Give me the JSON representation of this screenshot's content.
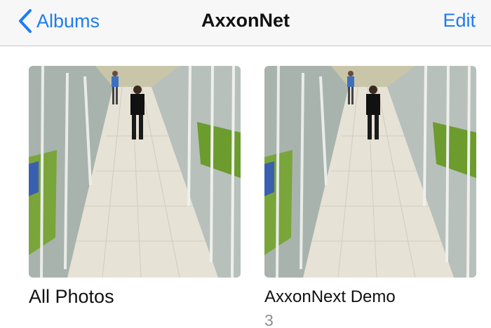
{
  "navbar": {
    "back_label": "Albums",
    "title": "AxxonNet",
    "edit_label": "Edit"
  },
  "albums": [
    {
      "name": "All Photos",
      "count": ""
    },
    {
      "name": "AxxonNext Demo",
      "count": "3"
    }
  ],
  "colors": {
    "accent": "#1e7cf2",
    "navbar_bg": "#f7f7f8",
    "count_text": "#8e8e93"
  },
  "icons": {
    "back": "chevron-left-icon"
  }
}
